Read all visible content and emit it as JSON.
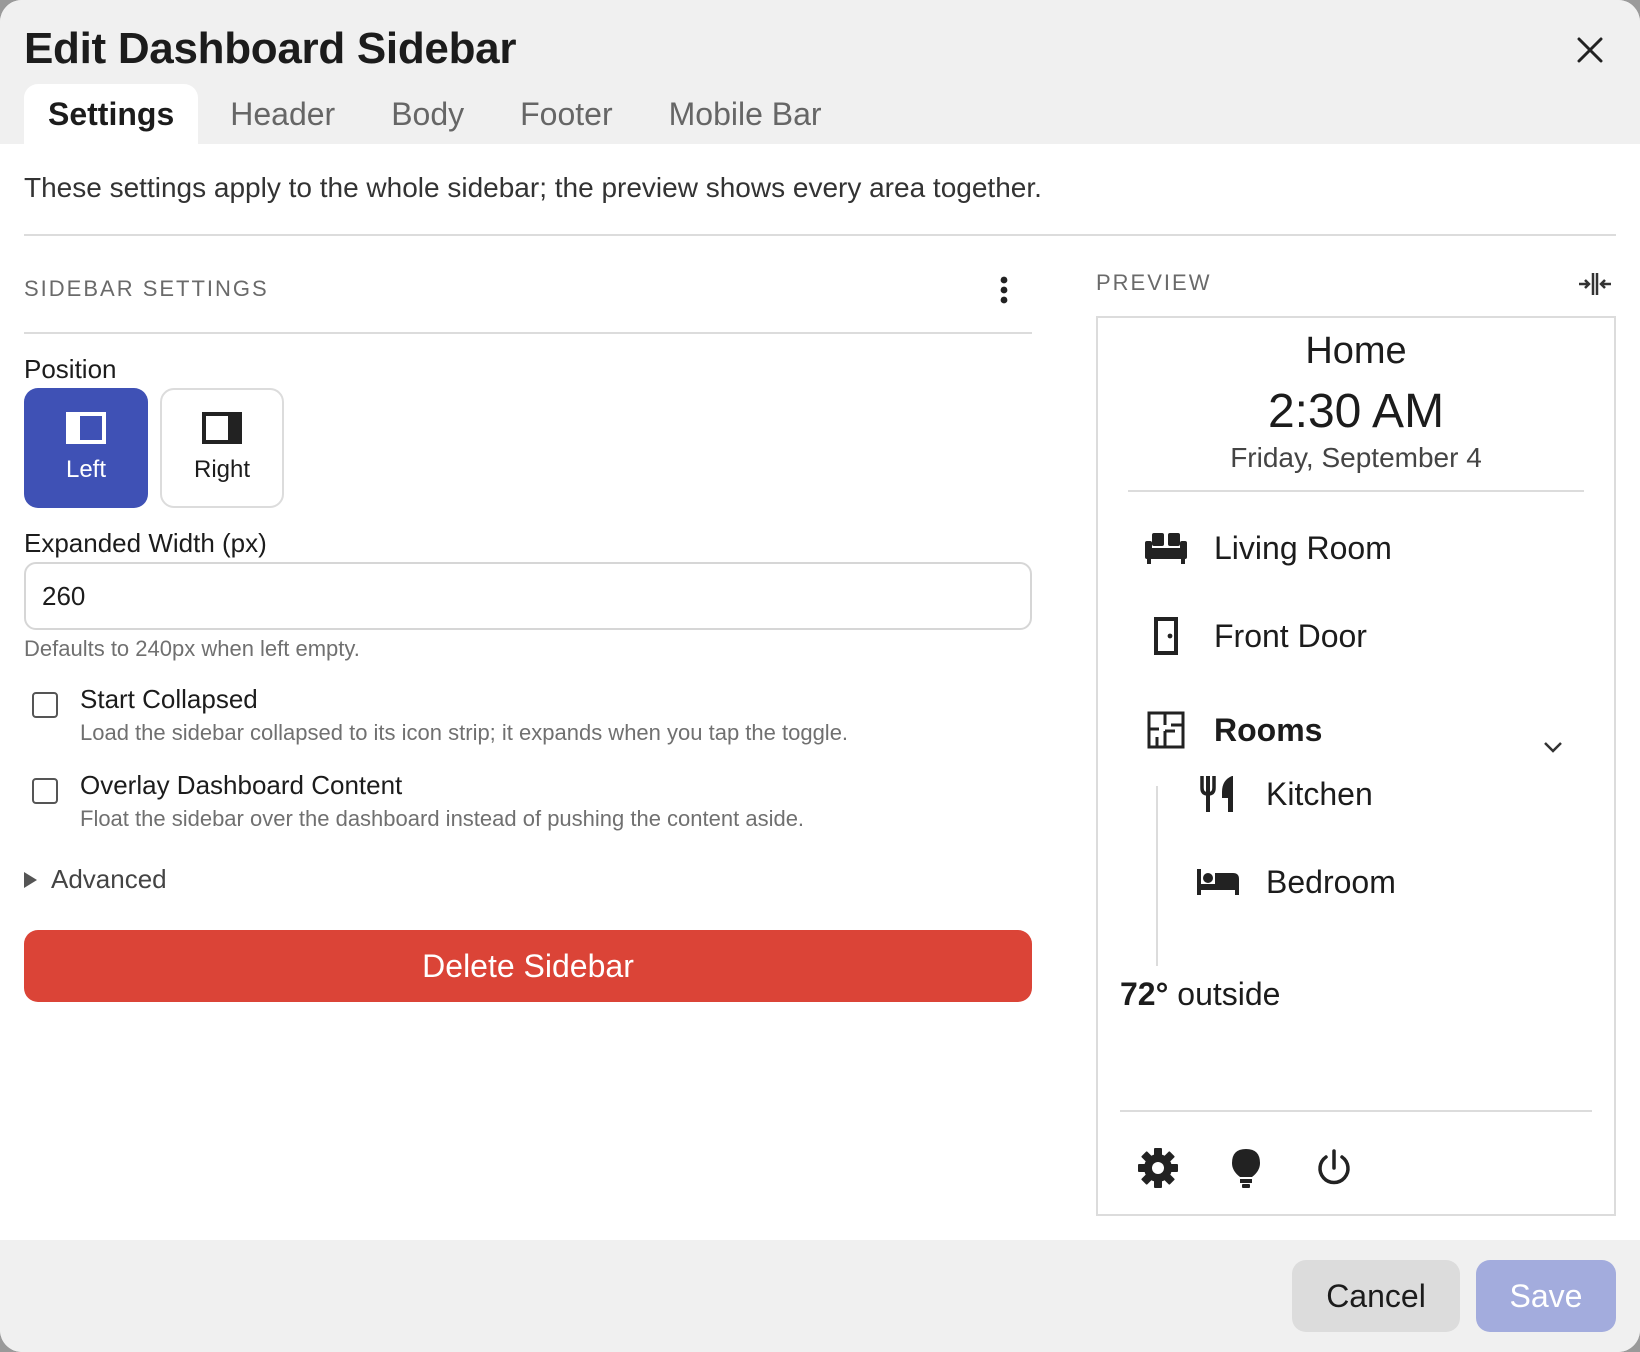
{
  "dialog": {
    "title": "Edit Dashboard Sidebar",
    "tabs": [
      {
        "label": "Settings",
        "active": true
      },
      {
        "label": "Header",
        "active": false
      },
      {
        "label": "Body",
        "active": false
      },
      {
        "label": "Footer",
        "active": false
      },
      {
        "label": "Mobile Bar",
        "active": false
      }
    ],
    "description": "These settings apply to the whole sidebar; the preview shows every area together."
  },
  "settings": {
    "section_title": "SIDEBAR SETTINGS",
    "position": {
      "label": "Position",
      "options": [
        {
          "label": "Left",
          "selected": true
        },
        {
          "label": "Right",
          "selected": false
        }
      ]
    },
    "width": {
      "label": "Expanded Width (px)",
      "value": "260",
      "hint": "Defaults to 240px when left empty."
    },
    "start_collapsed": {
      "label": "Start Collapsed",
      "description": "Load the sidebar collapsed to its icon strip; it expands when you tap the toggle.",
      "checked": false
    },
    "overlay": {
      "label": "Overlay Dashboard Content",
      "description": "Float the sidebar over the dashboard instead of pushing the content aside.",
      "checked": false
    },
    "advanced_label": "Advanced",
    "delete_label": "Delete Sidebar"
  },
  "preview": {
    "title": "PREVIEW",
    "header": {
      "home": "Home",
      "time": "2:30 AM",
      "date": "Friday, September 4"
    },
    "items": [
      {
        "label": "Living Room",
        "icon": "sofa-icon"
      },
      {
        "label": "Front Door",
        "icon": "door-icon"
      },
      {
        "label": "Rooms",
        "icon": "floor-plan-icon"
      },
      {
        "label": "Kitchen",
        "icon": "fork-knife-icon"
      },
      {
        "label": "Bedroom",
        "icon": "bed-icon"
      }
    ],
    "temperature": {
      "value": "72°",
      "suffix": " outside"
    },
    "footer_icons": [
      "gear-icon",
      "lightbulb-icon",
      "power-icon"
    ]
  },
  "footer": {
    "cancel_label": "Cancel",
    "save_label": "Save"
  },
  "colors": {
    "accent": "#3f51b5",
    "danger": "#db4437",
    "save_disabled": "#a3acdd"
  }
}
